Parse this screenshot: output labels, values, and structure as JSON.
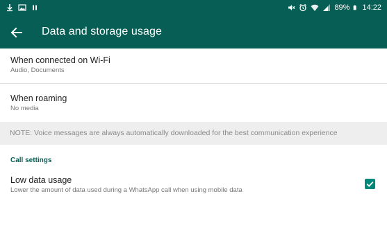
{
  "status_bar": {
    "battery": "89%",
    "time": "14:22",
    "left_icons": [
      "download-icon",
      "image-icon",
      "pause-icon"
    ],
    "right_icons": [
      "mute-icon",
      "alarm-icon",
      "wifi-icon",
      "signal-icon",
      "battery-icon"
    ]
  },
  "toolbar": {
    "title": "Data and storage usage",
    "back_icon": "arrow-left-icon"
  },
  "settings": {
    "wifi": {
      "title": "When connected on Wi-Fi",
      "summary": "Audio, Documents"
    },
    "roaming": {
      "title": "When roaming",
      "summary": "No media"
    },
    "note": "NOTE: Voice messages are always automatically downloaded for the best communication experience",
    "call_section": {
      "header": "Call settings",
      "low_data": {
        "title": "Low data usage",
        "summary": "Lower the amount of data used during a WhatsApp call when using mobile data",
        "checked": true
      }
    }
  },
  "colors": {
    "primary": "#075e54",
    "accent": "#00897b",
    "note_bg": "#eeeeee"
  }
}
